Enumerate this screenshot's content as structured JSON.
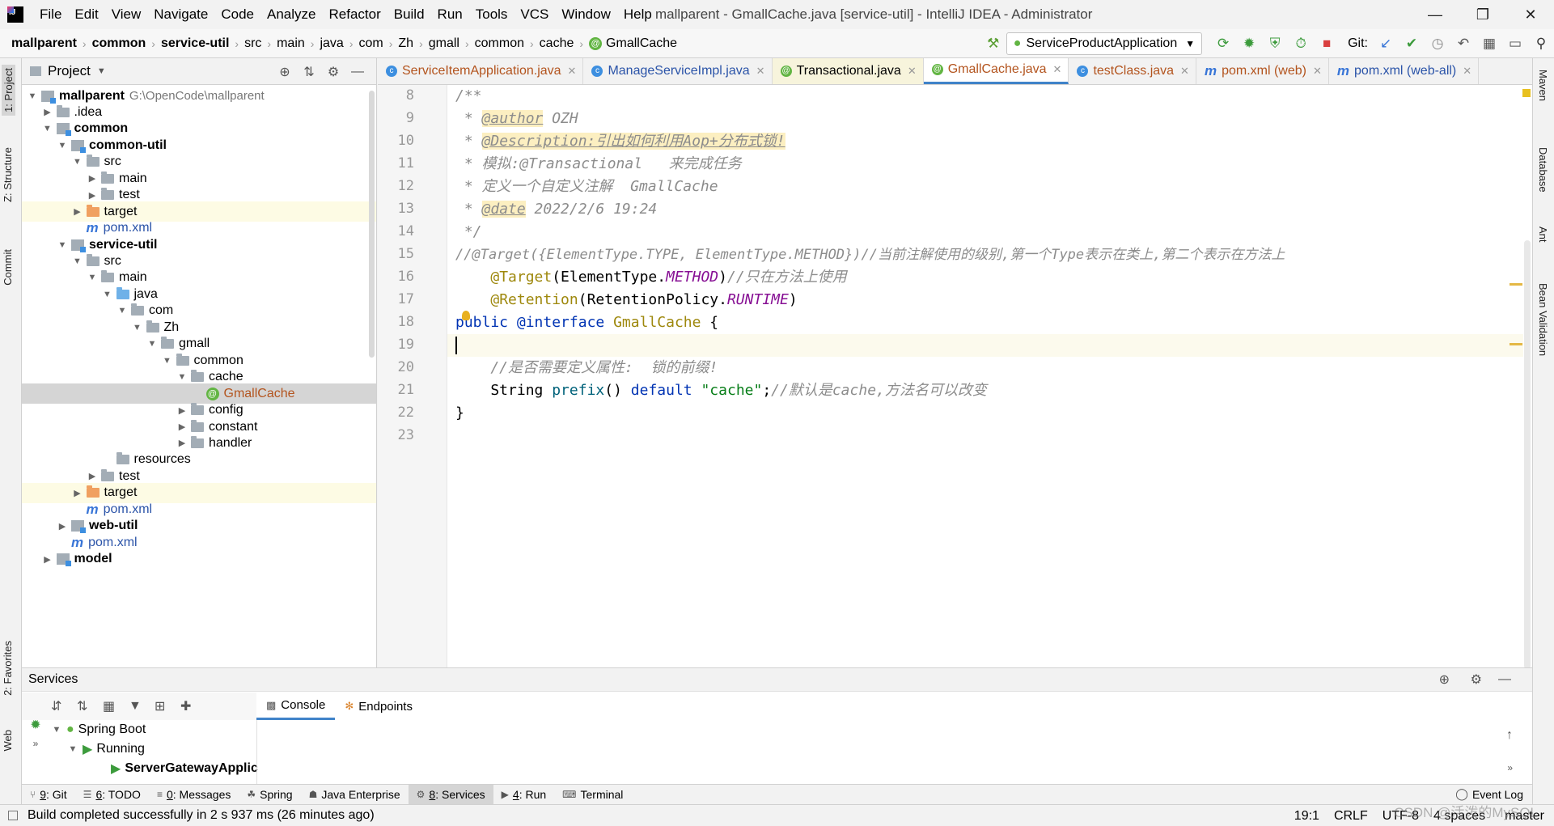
{
  "menubar": {
    "items": [
      "File",
      "Edit",
      "View",
      "Navigate",
      "Code",
      "Analyze",
      "Refactor",
      "Build",
      "Run",
      "Tools",
      "VCS",
      "Window",
      "Help"
    ],
    "window_title": "mallparent - GmallCache.java [service-util] - IntelliJ IDEA - Administrator"
  },
  "breadcrumb": [
    "mallparent",
    "common",
    "service-util",
    "src",
    "main",
    "java",
    "com",
    "Zh",
    "gmall",
    "common",
    "cache",
    "GmallCache"
  ],
  "toolbar": {
    "run_config": "ServiceProductApplication",
    "git_label": "Git:"
  },
  "left_strip": [
    "1: Project",
    "Z: Structure",
    "Commit",
    "2: Favorites",
    "Web"
  ],
  "right_strip": [
    "Maven",
    "Database",
    "Ant",
    "Bean Validation"
  ],
  "project_panel": {
    "title": "Project",
    "tree": [
      {
        "label": "mallparent",
        "extra": "G:\\OpenCode\\mallparent",
        "depth": 0,
        "arrow": "down",
        "icon": "module",
        "bold": true
      },
      {
        "label": ".idea",
        "depth": 1,
        "arrow": "right",
        "icon": "folder"
      },
      {
        "label": "common",
        "depth": 1,
        "arrow": "down",
        "icon": "module",
        "bold": true
      },
      {
        "label": "common-util",
        "depth": 2,
        "arrow": "down",
        "icon": "module",
        "bold": true
      },
      {
        "label": "src",
        "depth": 3,
        "arrow": "down",
        "icon": "folder"
      },
      {
        "label": "main",
        "depth": 4,
        "arrow": "right",
        "icon": "folder"
      },
      {
        "label": "test",
        "depth": 4,
        "arrow": "right",
        "icon": "folder"
      },
      {
        "label": "target",
        "depth": 3,
        "arrow": "right",
        "icon": "folder-orange",
        "hl": true
      },
      {
        "label": "pom.xml",
        "depth": 3,
        "arrow": "",
        "icon": "maven",
        "color": "blue"
      },
      {
        "label": "service-util",
        "depth": 2,
        "arrow": "down",
        "icon": "module",
        "bold": true
      },
      {
        "label": "src",
        "depth": 3,
        "arrow": "down",
        "icon": "folder"
      },
      {
        "label": "main",
        "depth": 4,
        "arrow": "down",
        "icon": "folder"
      },
      {
        "label": "java",
        "depth": 5,
        "arrow": "down",
        "icon": "folder-blue"
      },
      {
        "label": "com",
        "depth": 6,
        "arrow": "down",
        "icon": "folder"
      },
      {
        "label": "Zh",
        "depth": 7,
        "arrow": "down",
        "icon": "folder"
      },
      {
        "label": "gmall",
        "depth": 8,
        "arrow": "down",
        "icon": "folder"
      },
      {
        "label": "common",
        "depth": 9,
        "arrow": "down",
        "icon": "folder"
      },
      {
        "label": "cache",
        "depth": 10,
        "arrow": "down",
        "icon": "folder"
      },
      {
        "label": "GmallCache",
        "depth": 11,
        "arrow": "",
        "icon": "annotation",
        "color": "orange",
        "sel": true
      },
      {
        "label": "config",
        "depth": 10,
        "arrow": "right",
        "icon": "folder"
      },
      {
        "label": "constant",
        "depth": 10,
        "arrow": "right",
        "icon": "folder"
      },
      {
        "label": "handler",
        "depth": 10,
        "arrow": "right",
        "icon": "folder"
      },
      {
        "label": "resources",
        "depth": 5,
        "arrow": "",
        "icon": "folder-res"
      },
      {
        "label": "test",
        "depth": 4,
        "arrow": "right",
        "icon": "folder"
      },
      {
        "label": "target",
        "depth": 3,
        "arrow": "right",
        "icon": "folder-orange",
        "hl": true
      },
      {
        "label": "pom.xml",
        "depth": 3,
        "arrow": "",
        "icon": "maven",
        "color": "blue"
      },
      {
        "label": "web-util",
        "depth": 2,
        "arrow": "right",
        "icon": "module",
        "bold": true
      },
      {
        "label": "pom.xml",
        "depth": 2,
        "arrow": "",
        "icon": "maven",
        "color": "blue"
      },
      {
        "label": "model",
        "depth": 1,
        "arrow": "right",
        "icon": "module",
        "bold": true
      }
    ]
  },
  "editor": {
    "tabs": [
      {
        "label": "ServiceItemApplication.java",
        "icon": "class",
        "color": "orange"
      },
      {
        "label": "ManageServiceImpl.java",
        "icon": "class",
        "color": "blue"
      },
      {
        "label": "Transactional.java",
        "icon": "annotation",
        "color": "black",
        "yellow": true
      },
      {
        "label": "GmallCache.java",
        "icon": "annotation",
        "color": "orange",
        "active": true
      },
      {
        "label": "testClass.java",
        "icon": "class",
        "color": "orange"
      },
      {
        "label": "pom.xml (web)",
        "icon": "maven",
        "color": "orange"
      },
      {
        "label": "pom.xml (web-all)",
        "icon": "maven",
        "color": "blue"
      }
    ],
    "line_numbers": [
      "8",
      "9",
      "10",
      "11",
      "12",
      "13",
      "14",
      "15",
      "16",
      "17",
      "18",
      "19",
      "20",
      "21",
      "22",
      "23"
    ],
    "code": {
      "l8": "/**",
      "l9_star": " * ",
      "l9_tag": "@author",
      "l9_rest": " OZH",
      "l10_star": " * ",
      "l10_text": "@Description:引出如何利用Aop+分布式锁!",
      "l11": " * 模拟:@Transactional   来完成任务",
      "l12": " * 定义一个自定义注解  GmallCache",
      "l13_star": " * ",
      "l13_tag": "@date",
      "l13_rest": " 2022/2/6 19:24",
      "l14": " */",
      "l15": "//@Target({ElementType.TYPE, ElementType.METHOD})//当前注解使用的级别,第一个Type表示在类上,第二个表示在方法上",
      "l16_anno": "@Target",
      "l16_a": "(ElementType.",
      "l16_const": "METHOD",
      "l16_b": ")",
      "l16_cm": "//只在方法上使用",
      "l17_anno": "@Retention",
      "l17_a": "(RetentionPolicy.",
      "l17_const": "RUNTIME",
      "l17_b": ")",
      "l18_kw1": "public",
      "l18_kw2": "@interface",
      "l18_name": "GmallCache",
      "l18_b": " {",
      "l20": "    //是否需要定义属性:  锁的前缀!",
      "l21_type": "    String ",
      "l21_fn": "prefix",
      "l21_a": "() ",
      "l21_kw": "default",
      "l21_str": "\"cache\"",
      "l21_b": ";",
      "l21_cm": "//默认是cache,方法名可以改变",
      "l22": "}"
    }
  },
  "services": {
    "title": "Services",
    "tabs": [
      "Console",
      "Endpoints"
    ],
    "tree": [
      "Spring Boot",
      "Running",
      "ServerGatewayApplic"
    ]
  },
  "bottom_tools": [
    {
      "num": "9",
      "label": ": Git"
    },
    {
      "num": "6",
      "label": ": TODO"
    },
    {
      "num": "0",
      "label": ": Messages"
    },
    {
      "num": "",
      "label": "Spring"
    },
    {
      "num": "",
      "label": "Java Enterprise"
    },
    {
      "num": "8",
      "label": ": Services",
      "active": true
    },
    {
      "num": "4",
      "label": ": Run"
    },
    {
      "num": "",
      "label": "Terminal"
    }
  ],
  "event_log": "Event Log",
  "statusbar": {
    "message": "Build completed successfully in 2 s 937 ms (26 minutes ago)",
    "position": "19:1",
    "line_sep": "CRLF",
    "encoding": "UTF-8",
    "indent": "4 spaces",
    "branch": "master"
  },
  "watermark": "CSDN @活泼的MySQL"
}
